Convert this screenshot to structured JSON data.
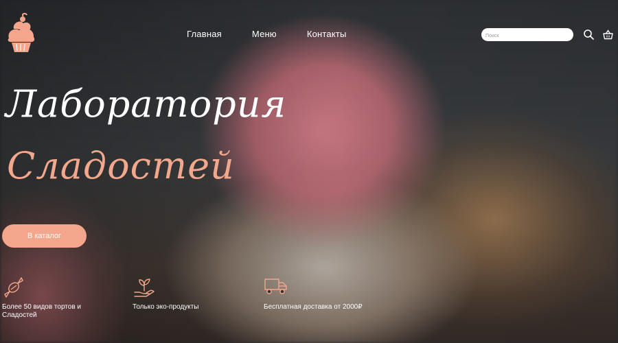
{
  "nav": {
    "items": [
      "Главная",
      "Меню",
      "Контакты"
    ]
  },
  "search": {
    "placeholder": "Поиск"
  },
  "hero": {
    "title_line1": "Лаборатория",
    "title_line2": "Сладостей",
    "catalog_button": "В каталог"
  },
  "features": [
    {
      "icon": "candy-icon",
      "text": "Более 50 видов тортов и Сладостей"
    },
    {
      "icon": "plant-hand-icon",
      "text": "Только эко-продукты"
    },
    {
      "icon": "truck-icon",
      "text": "Бесплатная доставка от 2000₽"
    }
  ],
  "colors": {
    "accent": "#f4a68c",
    "title_accent": "#f2a88d",
    "text": "#ffffff"
  }
}
